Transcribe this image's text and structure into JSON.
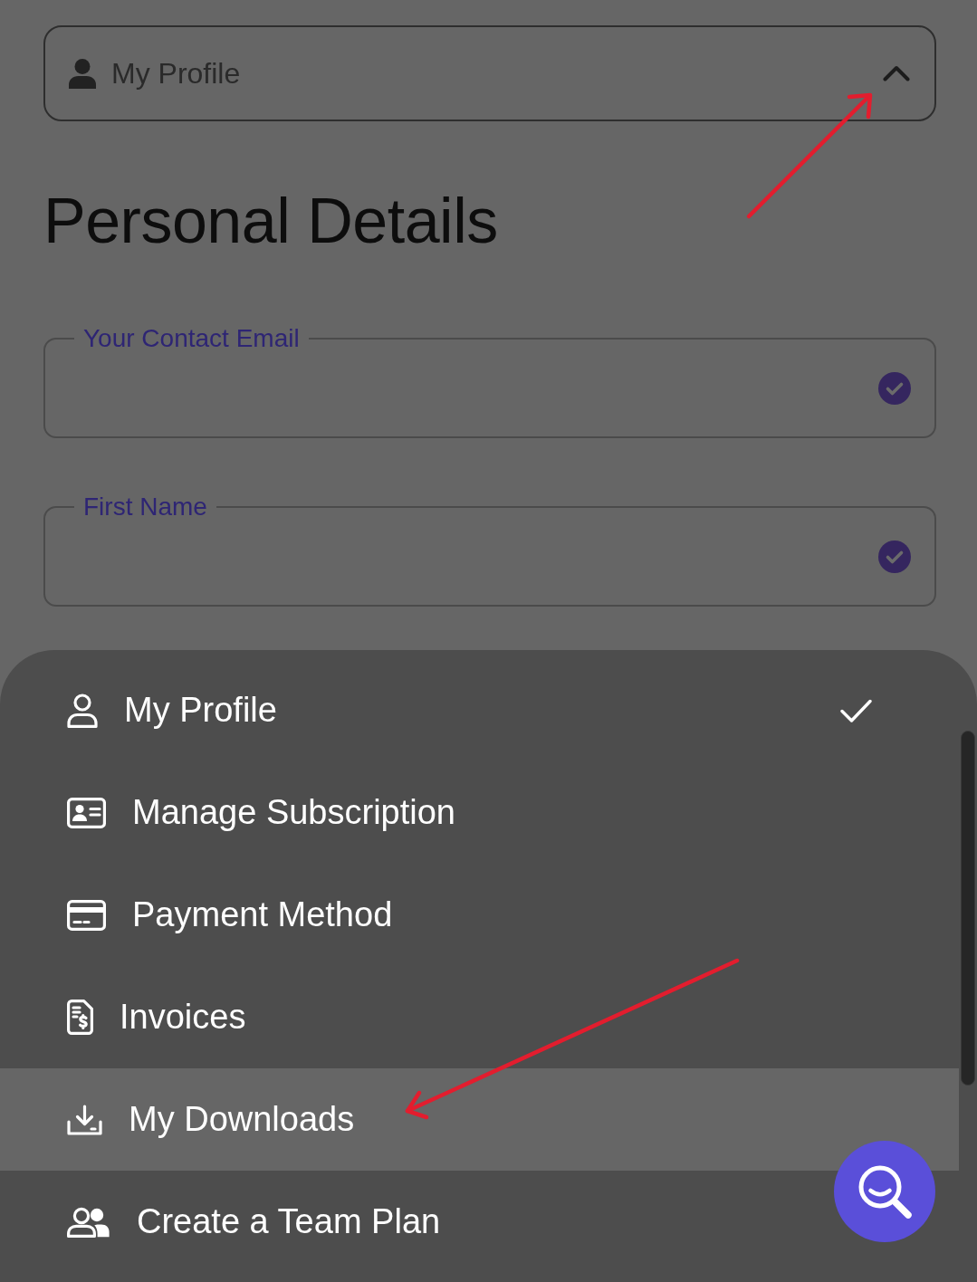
{
  "profile_dropdown": {
    "label": "My Profile",
    "expanded": true
  },
  "heading": "Personal Details",
  "fields": [
    {
      "label": "Your Contact Email",
      "verified": true
    },
    {
      "label": "First Name",
      "verified": true
    }
  ],
  "menu": {
    "items": [
      {
        "label": "My Profile",
        "selected": true,
        "highlighted": false
      },
      {
        "label": "Manage Subscription",
        "selected": false,
        "highlighted": false
      },
      {
        "label": "Payment Method",
        "selected": false,
        "highlighted": false
      },
      {
        "label": "Invoices",
        "selected": false,
        "highlighted": false
      },
      {
        "label": "My Downloads",
        "selected": false,
        "highlighted": true
      },
      {
        "label": "Create a Team Plan",
        "selected": false,
        "highlighted": false
      }
    ]
  }
}
